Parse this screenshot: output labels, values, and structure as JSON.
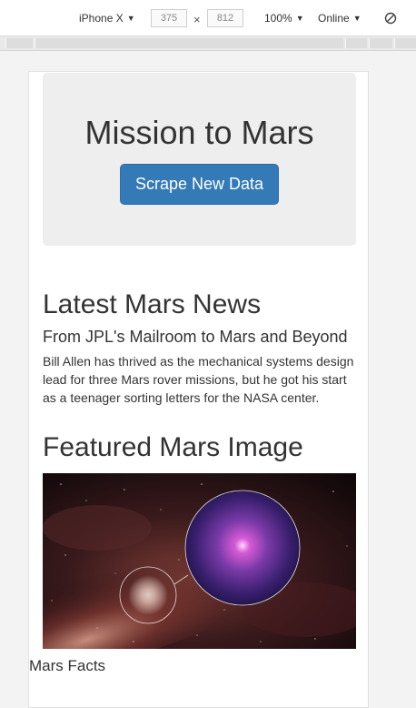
{
  "devtools": {
    "device": "iPhone X",
    "width": "375",
    "times": "×",
    "height": "812",
    "zoom": "100%",
    "network": "Online",
    "rotate_icon": "rotate-icon"
  },
  "page": {
    "jumbotron": {
      "title": "Mission to Mars",
      "button_label": "Scrape New Data"
    },
    "news": {
      "heading": "Latest Mars News",
      "title": "From JPL's Mailroom to Mars and Beyond",
      "body": "Bill Allen has thrived as the mechanical systems design lead for three Mars rover missions, but he got his start as a teenager sorting letters for the NASA center."
    },
    "featured": {
      "heading": "Featured Mars Image"
    },
    "facts": {
      "heading": "Mars Facts"
    }
  }
}
